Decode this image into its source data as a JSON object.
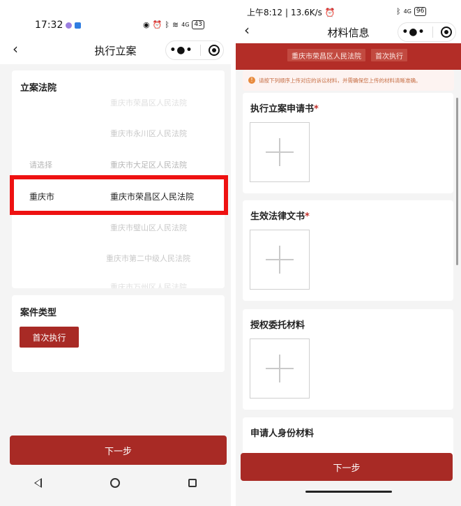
{
  "left": {
    "status": {
      "time": "17:32",
      "battery": "43",
      "signal": "4G"
    },
    "nav": {
      "title": "执行立案"
    },
    "court_section": {
      "title": "立案法院",
      "cities": [
        "请选择",
        "重庆市"
      ],
      "courts": [
        "重庆市荣昌区人民法院",
        "重庆市永川区人民法院",
        "重庆市大足区人民法院",
        "重庆市荣昌区人民法院",
        "重庆市璧山区人民法院",
        "重庆市第二中级人民法院",
        "重庆市万州区人民法院"
      ]
    },
    "case_section": {
      "title": "案件类型",
      "button": "首次执行"
    },
    "next_button": "下一步"
  },
  "right": {
    "status": {
      "time": "上午8:12",
      "speed": "13.6K/s",
      "battery": "96",
      "signal": "4G"
    },
    "nav": {
      "title": "材料信息"
    },
    "tags": [
      "重庆市荣昌区人民法院",
      "首次执行"
    ],
    "notice": "请按下列顺序上传对应的诉讼材料，并需确保您上传的材料清晰准确。",
    "sections": [
      {
        "title": "执行立案申请书",
        "required": "*"
      },
      {
        "title": "生效法律文书",
        "required": "*"
      },
      {
        "title": "授权委托材料",
        "required": ""
      },
      {
        "title": "申请人身份材料",
        "required": ""
      }
    ],
    "next_button": "下一步"
  },
  "colors": {
    "brand_red": "#a82a25",
    "highlight_red": "#ee1111",
    "notice_text": "#c66e44"
  },
  "icons": [
    "back-icon",
    "more-icon",
    "target-icon",
    "plus-icon",
    "warn-icon",
    "nav-back-triangle-icon",
    "nav-home-circle-icon",
    "nav-recents-square-icon",
    "eye-icon",
    "alarm-icon",
    "bluetooth-icon",
    "wifi-icon"
  ]
}
